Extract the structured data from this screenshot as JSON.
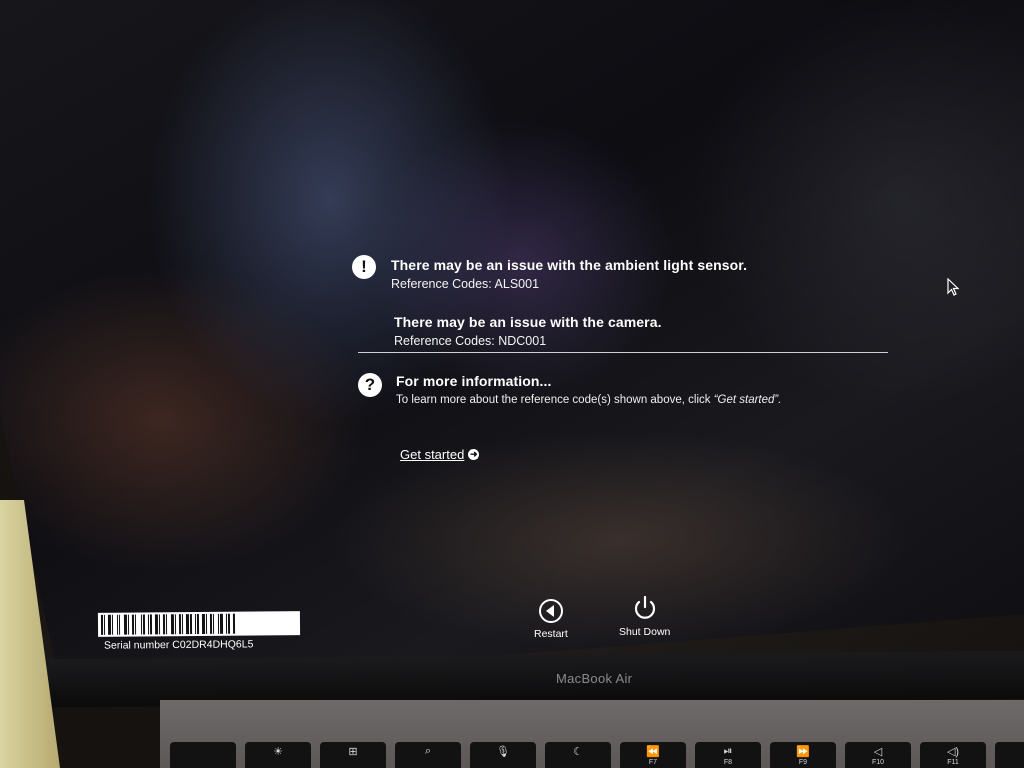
{
  "issues": [
    {
      "title": "There may be an issue with the ambient light sensor.",
      "code": "Reference Codes: ALS001",
      "icon": "exclamation-icon"
    },
    {
      "title": "There may be an issue with the camera.",
      "code": "Reference Codes: NDC001"
    }
  ],
  "more_info": {
    "icon": "question-icon",
    "icon_glyph": "?",
    "title": "For more information...",
    "body": "To learn more about the reference code(s) shown above, click ",
    "body_link": "“Get started”."
  },
  "get_started": {
    "label": "Get started",
    "icon": "arrow-right-circle-icon"
  },
  "serial": {
    "label": "Serial number C02DR4DHQ6L5"
  },
  "buttons": {
    "restart": {
      "label": "Restart",
      "icon": "restart-icon"
    },
    "shutdown": {
      "label": "Shut Down",
      "icon": "power-icon"
    }
  },
  "device": {
    "brand": "MacBook Air"
  },
  "keyboard": {
    "keys": [
      {
        "glyph": "",
        "fn": ""
      },
      {
        "glyph": "☀",
        "fn": ""
      },
      {
        "glyph": "⊞",
        "fn": ""
      },
      {
        "glyph": "⌕",
        "fn": ""
      },
      {
        "glyph": "🎙",
        "fn": ""
      },
      {
        "glyph": "☾",
        "fn": ""
      },
      {
        "glyph": "⏪",
        "fn": "F7"
      },
      {
        "glyph": "⏯",
        "fn": "F8"
      },
      {
        "glyph": "⏩",
        "fn": "F9"
      },
      {
        "glyph": "◁",
        "fn": "F10"
      },
      {
        "glyph": "◁)",
        "fn": "F11"
      },
      {
        "glyph": "",
        "fn": ""
      }
    ]
  },
  "colors": {
    "text": "#ffffff",
    "screen_bg": "#0d0d12",
    "divider": "#cfcfd4"
  }
}
